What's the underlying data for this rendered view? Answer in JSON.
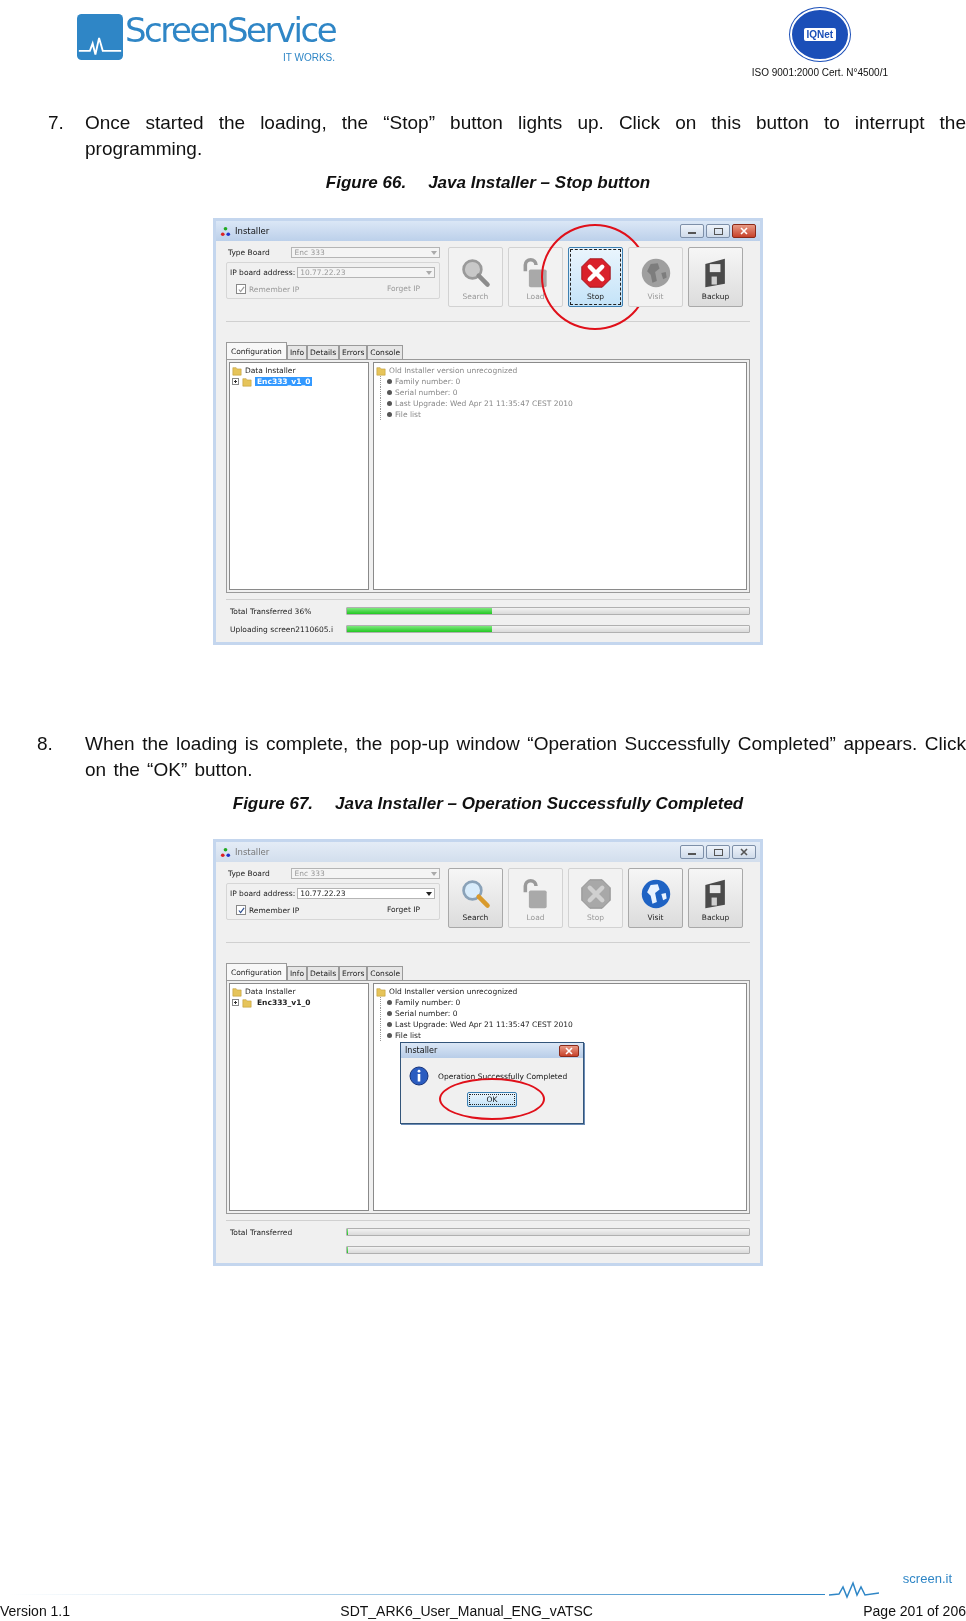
{
  "header": {
    "logo": {
      "wordmark": "ScreenService",
      "tagline": "IT WORKS."
    },
    "certification": {
      "badge": "IQNet",
      "text": "ISO 9001:2000 Cert. N°4500/1"
    }
  },
  "steps": [
    {
      "number": "7.",
      "text": "Once started the loading, the “Stop” button lights up. Click on this button to interrupt the programming.",
      "figure": {
        "label": "Figure 66.",
        "title": "Java Installer – Stop button",
        "window": {
          "title": "Installer",
          "active": true,
          "type_board": {
            "label": "Type Board",
            "value": "Enc 333",
            "disabled": true
          },
          "ip_address": {
            "label": "IP board address:",
            "value": "10.77.22.23",
            "disabled": true
          },
          "remember_ip": {
            "label": "Remember IP",
            "checked": true,
            "disabled": true
          },
          "forget_ip": {
            "label": "Forget IP",
            "disabled": true
          },
          "actions": [
            {
              "kind": "search",
              "label": "Search",
              "disabled": true,
              "focused": false,
              "circled": false
            },
            {
              "kind": "load",
              "label": "Load",
              "disabled": true,
              "focused": false,
              "circled": false
            },
            {
              "kind": "stop",
              "label": "Stop",
              "disabled": false,
              "focused": true,
              "circled": true
            },
            {
              "kind": "visit",
              "label": "Visit",
              "disabled": true,
              "focused": false,
              "circled": false
            },
            {
              "kind": "backup",
              "label": "Backup",
              "disabled": false,
              "focused": false,
              "circled": false
            }
          ],
          "tabs": [
            {
              "label": "Configuration",
              "selected": true
            },
            {
              "label": "Info",
              "selected": false
            },
            {
              "label": "Details",
              "selected": false
            },
            {
              "label": "Errors",
              "selected": false
            },
            {
              "label": "Console",
              "selected": false
            }
          ],
          "tree": {
            "label": "Data Installer",
            "children": [
              {
                "label": "Enc333_v1_0",
                "selected": true
              }
            ]
          },
          "details": {
            "label": "Old Installer version unrecognized",
            "disabled": true,
            "children": [
              {
                "label": "Family number: 0"
              },
              {
                "label": "Serial number: 0"
              },
              {
                "label": "Last Upgrade: Wed Apr 21 11:35:47 CEST 2010"
              },
              {
                "label": "File list"
              }
            ]
          },
          "progress": [
            {
              "label": "Total Transferred 36%",
              "level": 0.36
            },
            {
              "label": "Uploading screen2110605.i",
              "level": 0.36
            }
          ]
        }
      }
    },
    {
      "number": "8.",
      "text": "When the loading is complete, the pop-up window “Operation Successfully Completed” appears. Click on the “OK” button.",
      "figure": {
        "label": "Figure 67.",
        "title": "Java Installer – Operation Successfully Completed",
        "window": {
          "title": "Installer",
          "active": false,
          "type_board": {
            "label": "Type Board",
            "value": "Enc 333",
            "disabled": true
          },
          "ip_address": {
            "label": "IP board address:",
            "value": "10.77.22.23",
            "disabled": false
          },
          "remember_ip": {
            "label": "Remember IP",
            "checked": true,
            "disabled": false
          },
          "forget_ip": {
            "label": "Forget IP",
            "disabled": false
          },
          "actions": [
            {
              "kind": "search",
              "label": "Search",
              "disabled": false,
              "focused": false,
              "circled": false
            },
            {
              "kind": "load",
              "label": "Load",
              "disabled": true,
              "focused": false,
              "circled": false
            },
            {
              "kind": "stop",
              "label": "Stop",
              "disabled": true,
              "focused": false,
              "circled": false
            },
            {
              "kind": "visit",
              "label": "Visit",
              "disabled": false,
              "focused": false,
              "circled": false
            },
            {
              "kind": "backup",
              "label": "Backup",
              "disabled": false,
              "focused": false,
              "circled": false
            }
          ],
          "tabs": [
            {
              "label": "Configuration",
              "selected": true
            },
            {
              "label": "Info",
              "selected": false
            },
            {
              "label": "Details",
              "selected": false
            },
            {
              "label": "Errors",
              "selected": false
            },
            {
              "label": "Console",
              "selected": false
            }
          ],
          "tree": {
            "label": "Data Installer",
            "children": [
              {
                "label": "Enc333_v1_0",
                "selected": false
              }
            ]
          },
          "details": {
            "label": "Old Installer version unrecognized",
            "disabled": false,
            "children": [
              {
                "label": "Family number: 0"
              },
              {
                "label": "Serial number: 0"
              },
              {
                "label": "Last Upgrade: Wed Apr 21 11:35:47 CEST 2010"
              },
              {
                "label": "File list"
              }
            ]
          },
          "progress": [
            {
              "label": "Total Transferred",
              "level": 0
            },
            {
              "level": 0
            }
          ],
          "dialog": {
            "title": "Installer",
            "message": "Operation Successfully Completed",
            "button": {
              "label": "OK",
              "circled": true
            }
          }
        }
      }
    }
  ],
  "footer": {
    "brand": "screen.it",
    "version": "Version 1.1",
    "document": "SDT_ARK6_User_Manual_ENG_vATSC",
    "page": "Page 201 of 206"
  }
}
